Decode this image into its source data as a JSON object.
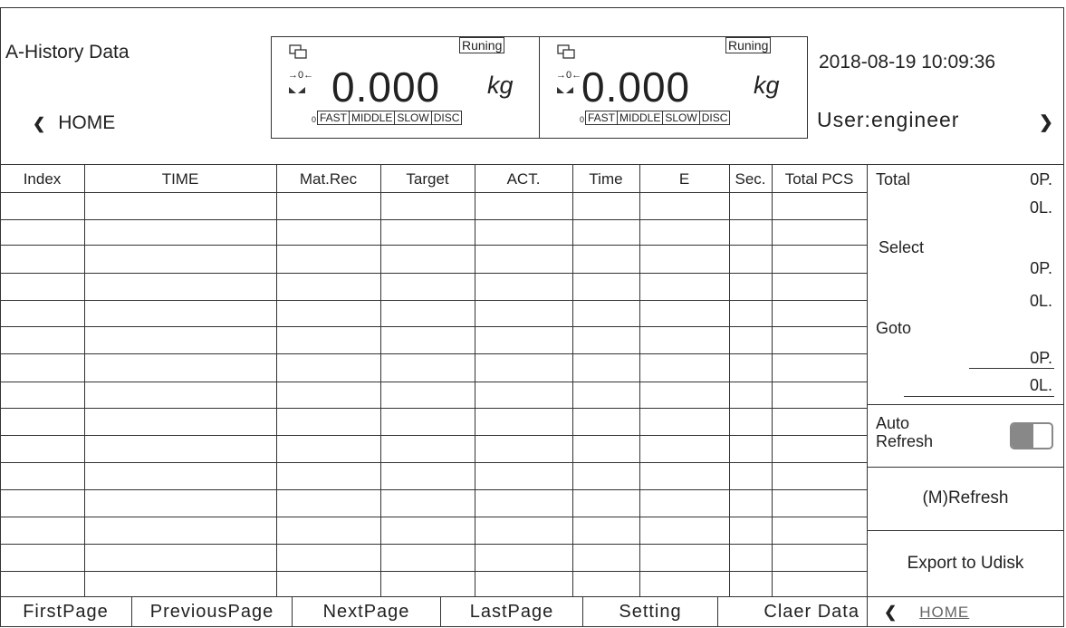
{
  "header": {
    "title": "A-History Data",
    "home_label": "HOME",
    "datetime": "2018-08-19 10:09:36",
    "user": "User:engineer"
  },
  "scales": [
    {
      "weight": "0.000",
      "unit": "kg",
      "status": "Runing",
      "zero_mark": "0",
      "states": [
        "FAST",
        "MIDDLE",
        "SLOW",
        "DISC"
      ]
    },
    {
      "weight": "0.000",
      "unit": "kg",
      "status": "Runing",
      "zero_mark": "0",
      "states": [
        "FAST",
        "MIDDLE",
        "SLOW",
        "DISC"
      ]
    }
  ],
  "table": {
    "columns": [
      "Index",
      "TIME",
      "Mat.Rec",
      "Target",
      "ACT.",
      "Time",
      "E",
      "Sec.",
      "Total PCS"
    ],
    "rows": []
  },
  "side": {
    "total_label": "Total",
    "total_p": "0P.",
    "total_l": "0L.",
    "select_label": "Select",
    "select_p": "0P.",
    "select_l": "0L.",
    "goto_label": "Goto",
    "goto_p": "0P.",
    "goto_l": "0L.",
    "auto_refresh_label_1": "Auto",
    "auto_refresh_label_2": "Refresh",
    "refresh_button": "(M)Refresh",
    "export_button": "Export to Udisk"
  },
  "bottom": {
    "first": "FirstPage",
    "previous": "PreviousPage",
    "next": "NextPage",
    "last": "LastPage",
    "setting": "Setting",
    "clear": "Claer Data",
    "home": "HOME"
  }
}
